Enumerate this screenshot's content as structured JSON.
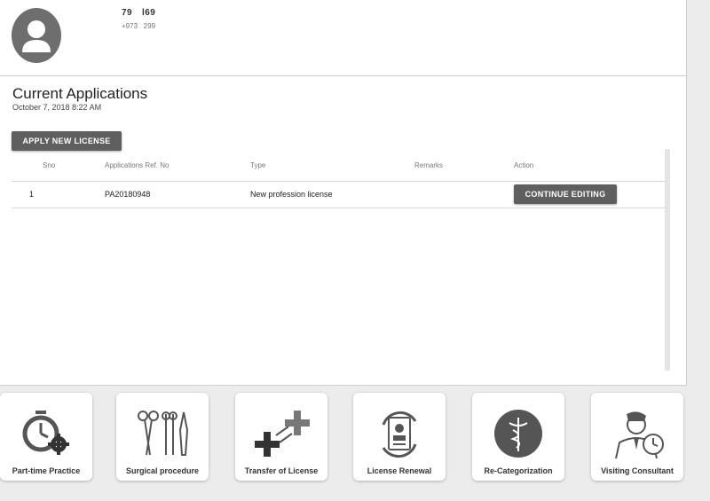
{
  "profile": {
    "name": "79     l69",
    "phone": "+973     299"
  },
  "applications": {
    "title": "Current Applications",
    "date": "October 7, 2018 8:22 AM",
    "apply_button": "APPLY NEW LICENSE",
    "columns": [
      "Sno",
      "Applications Ref. No",
      "Type",
      "Remarks",
      "Action"
    ],
    "rows": [
      {
        "sno": "1",
        "ref": "PA20180948",
        "type": "New profession license",
        "remarks": "",
        "action": "CONTINUE EDITING"
      }
    ]
  },
  "services": [
    {
      "label": "Part-time Practice",
      "icon": "stopwatch-gear-icon"
    },
    {
      "label": "Surgical procedure",
      "icon": "surgical-tools-icon"
    },
    {
      "label": "Transfer of License",
      "icon": "transfer-crosses-icon"
    },
    {
      "label": "License Renewal",
      "icon": "license-renewal-icon"
    },
    {
      "label": "Re-Categorization",
      "icon": "caduceus-icon"
    },
    {
      "label": "Visiting Consultant",
      "icon": "consultant-clock-icon"
    }
  ],
  "colors": {
    "button": "#5f5f5f",
    "background": "#ececec",
    "card": "#ffffff"
  }
}
